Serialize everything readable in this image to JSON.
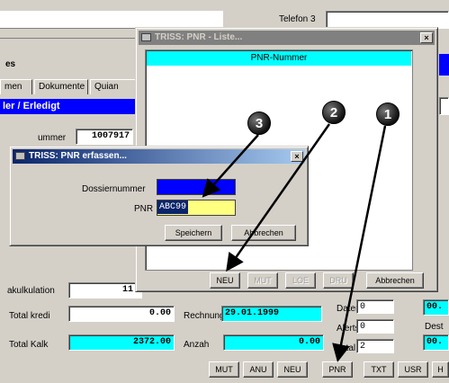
{
  "background": {
    "top_field_label": "Telefon 3",
    "left_label_es": "es",
    "tabs": [
      "men",
      "Dokumente",
      "Quian"
    ],
    "selected_bar_label": "ler / Erledigt",
    "dossier_label": "ummer",
    "dossier_value": "1007917",
    "total_kalkulation_label": "akulkulation",
    "total_kalkulation_value": "11'",
    "total_kredi_label": "Total kredi",
    "total_kredi_value": "0.00",
    "total_kalk_label": "Total Kalk",
    "total_kalk_value": "2372.00",
    "rechnung_label": "Rechnung",
    "rechnung_value": "29.01.1999",
    "anzah_label": "Anzah",
    "anzah_value": "0.00",
    "right_labels": [
      "Daten:",
      "Alerts:",
      "Total:"
    ],
    "right_values": [
      "0",
      "0",
      "2"
    ],
    "far_right_labels": [
      "Dest"
    ],
    "far_right_values": [
      "00.",
      "00."
    ],
    "bottom_buttons": [
      "MUT",
      "ANU",
      "NEU",
      "PNR",
      "TXT",
      "USR",
      "H"
    ]
  },
  "pnr_window": {
    "title": "TRISS: PNR - Liste...",
    "column_header": "PNR-Nummer",
    "close_glyph": "×",
    "buttons": [
      "NEU",
      "MUT",
      "LOE",
      "DRU",
      "Abbrechen"
    ]
  },
  "pnr_dialog": {
    "title": "TRISS: PNR erfassen...",
    "close_glyph": "×",
    "dossier_label": "Dossiernummer",
    "pnr_label": "PNR",
    "pnr_value": "ABC99",
    "save_label": "Speichern",
    "cancel_label": "Abbrechen"
  },
  "callouts": [
    "1",
    "2",
    "3"
  ]
}
